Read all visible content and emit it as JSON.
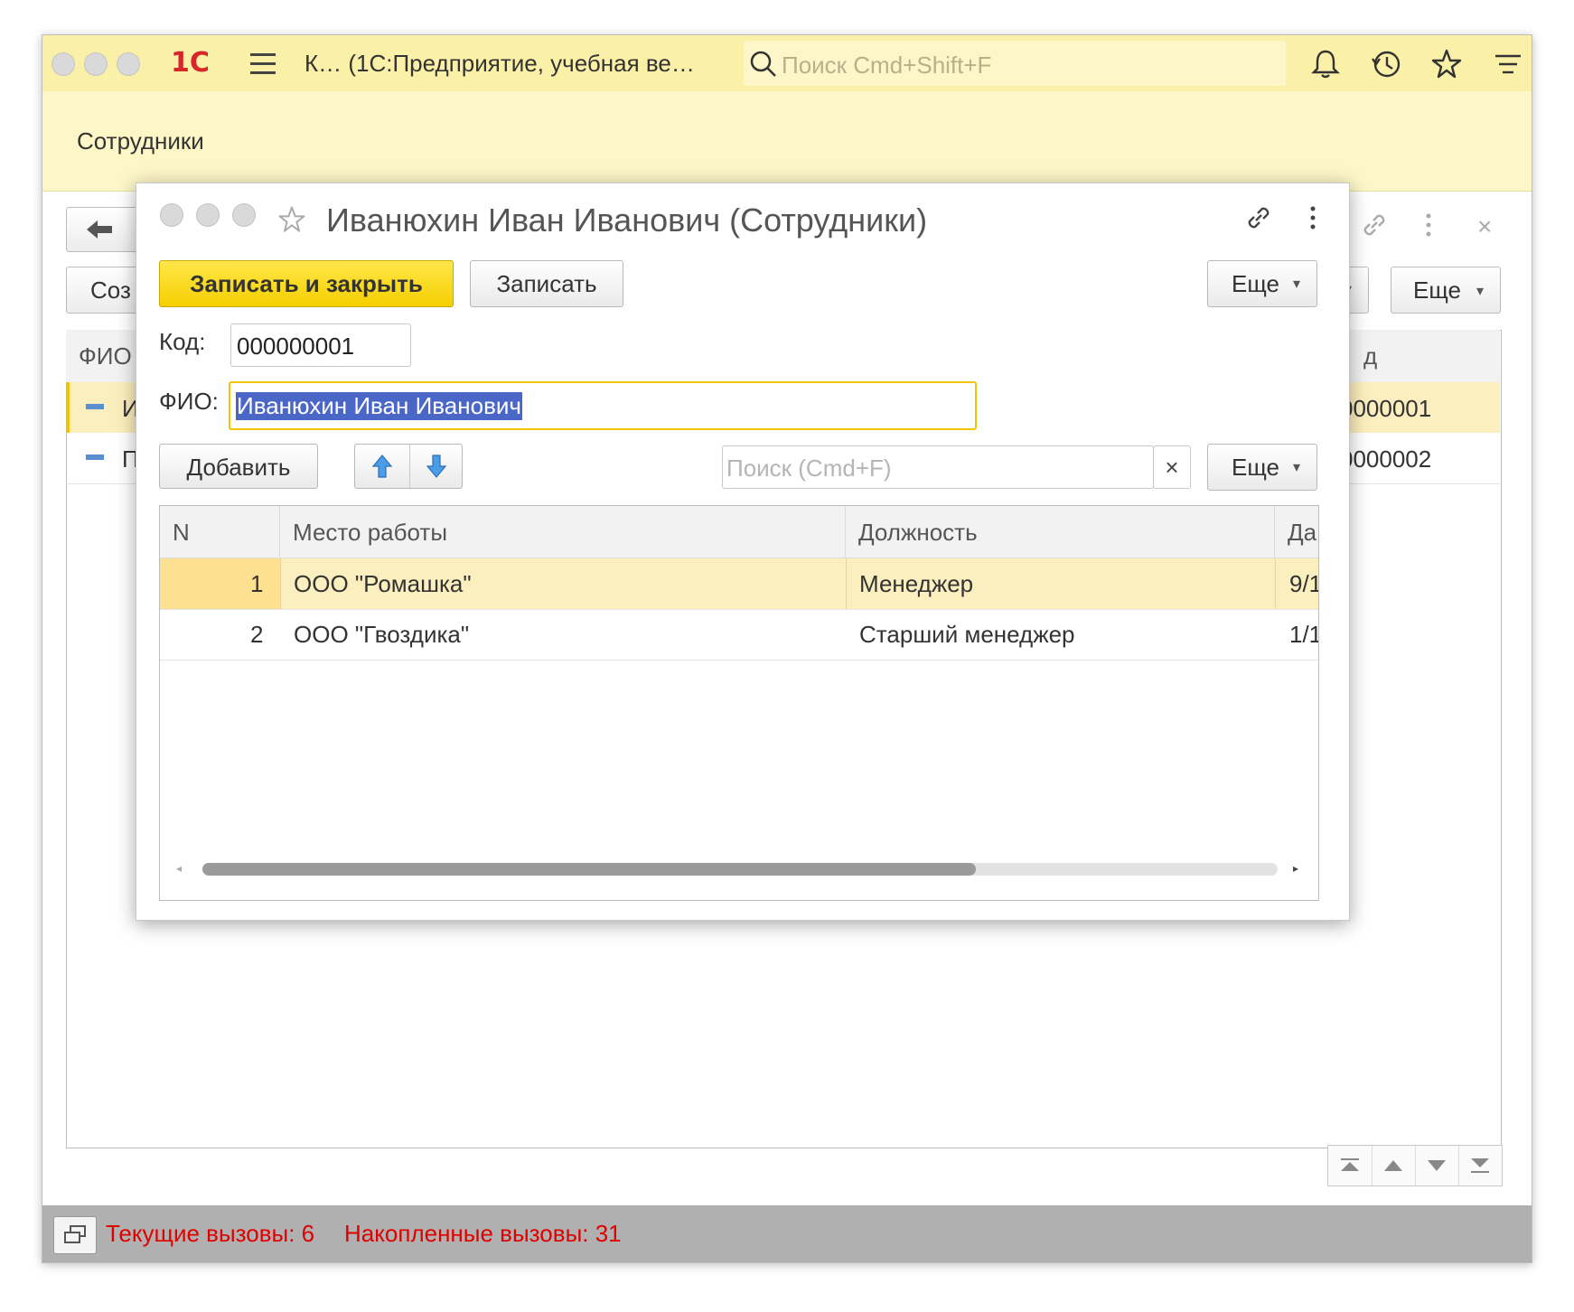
{
  "window": {
    "app_title": "К…  (1С:Предприятие, учебная ве…",
    "logo": "1С",
    "search_placeholder": "Поиск Cmd+Shift+F",
    "section_title": "Сотрудники"
  },
  "background_form": {
    "create_button": "Соз",
    "more_button": "Еще",
    "column_fio": "ФИО",
    "column_code": "д",
    "rows": [
      {
        "fio": "И",
        "code": "0000001"
      },
      {
        "fio": "П",
        "code": "0000002"
      }
    ]
  },
  "status": {
    "current_calls": "Текущие вызовы: 6",
    "accumulated_calls": "Накопленные вызовы: 31"
  },
  "dialog": {
    "title": "Иванюхин Иван Иванович (Сотрудники)",
    "save_close_button": "Записать и закрыть",
    "save_button": "Записать",
    "more_button": "Еще",
    "code_label": "Код:",
    "code_value": "000000001",
    "fio_label": "ФИО:",
    "fio_value": "Иванюхин Иван Иванович",
    "add_button": "Добавить",
    "table_search_placeholder": "Поиск (Cmd+F)",
    "clear_icon": "×",
    "table_more_button": "Еще",
    "table": {
      "headers": [
        "N",
        "Место работы",
        "Должность",
        "Да"
      ],
      "rows": [
        {
          "n": "1",
          "workplace": "ООО \"Ромашка\"",
          "position": "Менеджер",
          "date": "9/1"
        },
        {
          "n": "2",
          "workplace": "ООО \"Гвоздика\"",
          "position": "Старший менеджер",
          "date": "1/1"
        }
      ]
    }
  },
  "colors": {
    "title_bar": "#fbf0a8",
    "primary_button": "#f5cf00",
    "selected_row": "#fcefbf",
    "selection_highlight": "#4a67c7",
    "status_text": "#e00000"
  }
}
